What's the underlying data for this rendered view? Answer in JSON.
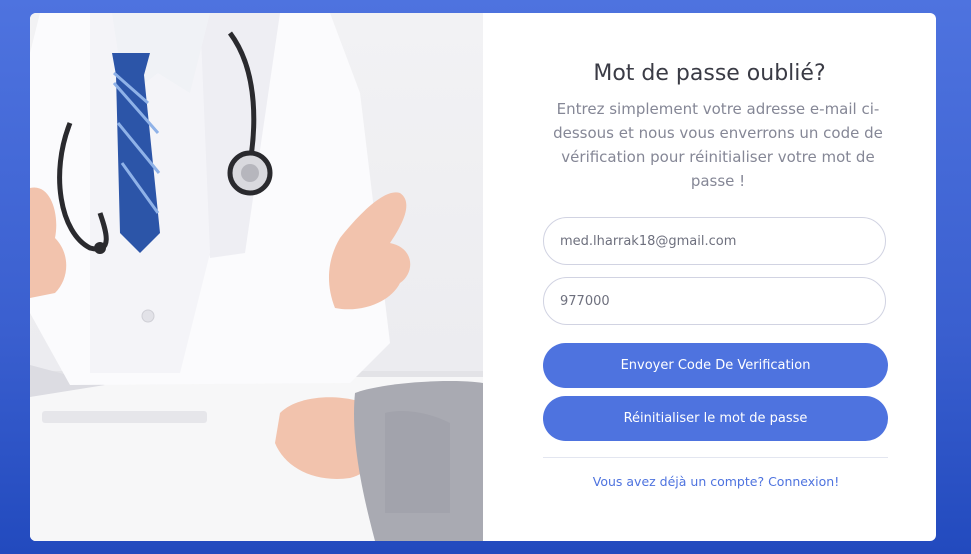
{
  "page": {
    "title": "Mot de passe oublié?",
    "subtitle": "Entrez simplement votre adresse e-mail ci-dessous et nous vous enverrons un code de vérification pour réinitialiser votre mot de passe !"
  },
  "form": {
    "email_value": "med.lharrak18@gmail.com",
    "code_value": "977000",
    "send_code_label": "Envoyer Code De Verification",
    "reset_label": "Réinitialiser le mot de passe",
    "login_link": "Vous avez déjà un compte? Connexion!"
  },
  "colors": {
    "primary": "#4e73df",
    "background_gradient": [
      "#4e73df",
      "#224abe"
    ]
  }
}
